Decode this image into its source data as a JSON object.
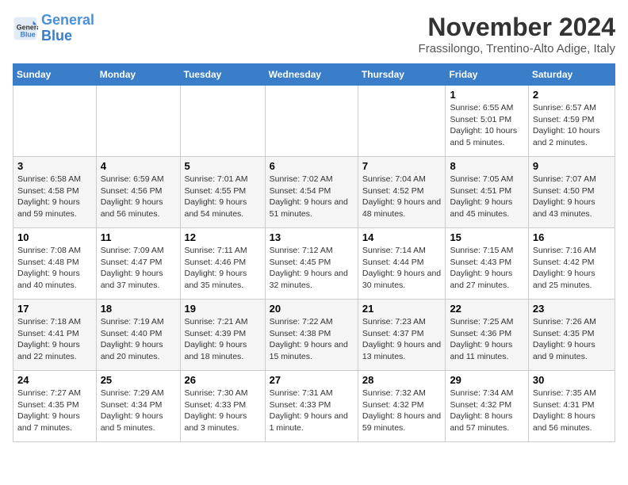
{
  "header": {
    "logo_line1": "General",
    "logo_line2": "Blue",
    "month": "November 2024",
    "location": "Frassilongo, Trentino-Alto Adige, Italy"
  },
  "weekdays": [
    "Sunday",
    "Monday",
    "Tuesday",
    "Wednesday",
    "Thursday",
    "Friday",
    "Saturday"
  ],
  "weeks": [
    [
      {
        "day": "",
        "info": ""
      },
      {
        "day": "",
        "info": ""
      },
      {
        "day": "",
        "info": ""
      },
      {
        "day": "",
        "info": ""
      },
      {
        "day": "",
        "info": ""
      },
      {
        "day": "1",
        "info": "Sunrise: 6:55 AM\nSunset: 5:01 PM\nDaylight: 10 hours and 5 minutes."
      },
      {
        "day": "2",
        "info": "Sunrise: 6:57 AM\nSunset: 4:59 PM\nDaylight: 10 hours and 2 minutes."
      }
    ],
    [
      {
        "day": "3",
        "info": "Sunrise: 6:58 AM\nSunset: 4:58 PM\nDaylight: 9 hours and 59 minutes."
      },
      {
        "day": "4",
        "info": "Sunrise: 6:59 AM\nSunset: 4:56 PM\nDaylight: 9 hours and 56 minutes."
      },
      {
        "day": "5",
        "info": "Sunrise: 7:01 AM\nSunset: 4:55 PM\nDaylight: 9 hours and 54 minutes."
      },
      {
        "day": "6",
        "info": "Sunrise: 7:02 AM\nSunset: 4:54 PM\nDaylight: 9 hours and 51 minutes."
      },
      {
        "day": "7",
        "info": "Sunrise: 7:04 AM\nSunset: 4:52 PM\nDaylight: 9 hours and 48 minutes."
      },
      {
        "day": "8",
        "info": "Sunrise: 7:05 AM\nSunset: 4:51 PM\nDaylight: 9 hours and 45 minutes."
      },
      {
        "day": "9",
        "info": "Sunrise: 7:07 AM\nSunset: 4:50 PM\nDaylight: 9 hours and 43 minutes."
      }
    ],
    [
      {
        "day": "10",
        "info": "Sunrise: 7:08 AM\nSunset: 4:48 PM\nDaylight: 9 hours and 40 minutes."
      },
      {
        "day": "11",
        "info": "Sunrise: 7:09 AM\nSunset: 4:47 PM\nDaylight: 9 hours and 37 minutes."
      },
      {
        "day": "12",
        "info": "Sunrise: 7:11 AM\nSunset: 4:46 PM\nDaylight: 9 hours and 35 minutes."
      },
      {
        "day": "13",
        "info": "Sunrise: 7:12 AM\nSunset: 4:45 PM\nDaylight: 9 hours and 32 minutes."
      },
      {
        "day": "14",
        "info": "Sunrise: 7:14 AM\nSunset: 4:44 PM\nDaylight: 9 hours and 30 minutes."
      },
      {
        "day": "15",
        "info": "Sunrise: 7:15 AM\nSunset: 4:43 PM\nDaylight: 9 hours and 27 minutes."
      },
      {
        "day": "16",
        "info": "Sunrise: 7:16 AM\nSunset: 4:42 PM\nDaylight: 9 hours and 25 minutes."
      }
    ],
    [
      {
        "day": "17",
        "info": "Sunrise: 7:18 AM\nSunset: 4:41 PM\nDaylight: 9 hours and 22 minutes."
      },
      {
        "day": "18",
        "info": "Sunrise: 7:19 AM\nSunset: 4:40 PM\nDaylight: 9 hours and 20 minutes."
      },
      {
        "day": "19",
        "info": "Sunrise: 7:21 AM\nSunset: 4:39 PM\nDaylight: 9 hours and 18 minutes."
      },
      {
        "day": "20",
        "info": "Sunrise: 7:22 AM\nSunset: 4:38 PM\nDaylight: 9 hours and 15 minutes."
      },
      {
        "day": "21",
        "info": "Sunrise: 7:23 AM\nSunset: 4:37 PM\nDaylight: 9 hours and 13 minutes."
      },
      {
        "day": "22",
        "info": "Sunrise: 7:25 AM\nSunset: 4:36 PM\nDaylight: 9 hours and 11 minutes."
      },
      {
        "day": "23",
        "info": "Sunrise: 7:26 AM\nSunset: 4:35 PM\nDaylight: 9 hours and 9 minutes."
      }
    ],
    [
      {
        "day": "24",
        "info": "Sunrise: 7:27 AM\nSunset: 4:35 PM\nDaylight: 9 hours and 7 minutes."
      },
      {
        "day": "25",
        "info": "Sunrise: 7:29 AM\nSunset: 4:34 PM\nDaylight: 9 hours and 5 minutes."
      },
      {
        "day": "26",
        "info": "Sunrise: 7:30 AM\nSunset: 4:33 PM\nDaylight: 9 hours and 3 minutes."
      },
      {
        "day": "27",
        "info": "Sunrise: 7:31 AM\nSunset: 4:33 PM\nDaylight: 9 hours and 1 minute."
      },
      {
        "day": "28",
        "info": "Sunrise: 7:32 AM\nSunset: 4:32 PM\nDaylight: 8 hours and 59 minutes."
      },
      {
        "day": "29",
        "info": "Sunrise: 7:34 AM\nSunset: 4:32 PM\nDaylight: 8 hours and 57 minutes."
      },
      {
        "day": "30",
        "info": "Sunrise: 7:35 AM\nSunset: 4:31 PM\nDaylight: 8 hours and 56 minutes."
      }
    ]
  ]
}
